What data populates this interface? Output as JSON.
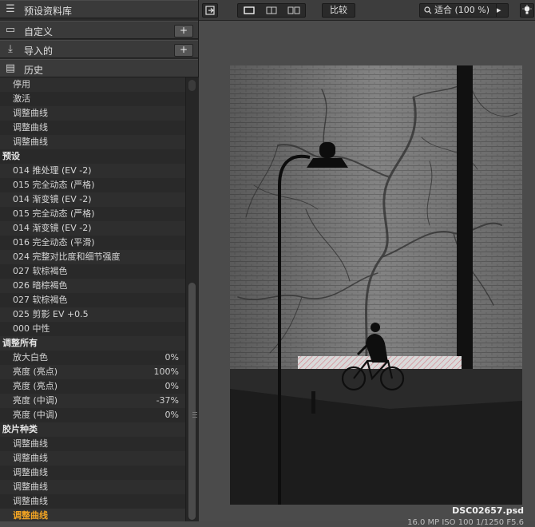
{
  "panels": {
    "presets_library": {
      "label": "预设资料库",
      "icon": "list-icon"
    },
    "custom": {
      "label": "自定义",
      "icon": "custom-icon",
      "add": "+"
    },
    "imported": {
      "label": "导入的",
      "icon": "import-icon",
      "add": "+"
    },
    "history": {
      "label": "历史",
      "icon": "history-icon"
    }
  },
  "history": [
    {
      "label": "停用"
    },
    {
      "label": "激活"
    },
    {
      "label": "调整曲线"
    },
    {
      "label": "调整曲线"
    },
    {
      "label": "调整曲线"
    },
    {
      "label": "预设",
      "group": true
    },
    {
      "label": "014 推处理 (EV -2)"
    },
    {
      "label": "015 完全动态 (严格)"
    },
    {
      "label": "014 渐变镜 (EV -2)"
    },
    {
      "label": "015 完全动态 (严格)"
    },
    {
      "label": "014 渐变镜 (EV -2)"
    },
    {
      "label": "016 完全动态 (平滑)"
    },
    {
      "label": "024 完整对比度和细节强度"
    },
    {
      "label": "027 软棕褐色"
    },
    {
      "label": "026 暗棕褐色"
    },
    {
      "label": "027 软棕褐色"
    },
    {
      "label": "025 剪影 EV +0.5"
    },
    {
      "label": "000 中性"
    },
    {
      "label": "调整所有",
      "group": true
    },
    {
      "label": "放大白色",
      "value": "0%"
    },
    {
      "label": "亮度 (亮点)",
      "value": "100%"
    },
    {
      "label": "亮度 (亮点)",
      "value": "0%"
    },
    {
      "label": "亮度 (中调)",
      "value": "-37%"
    },
    {
      "label": "亮度 (中调)",
      "value": "0%"
    },
    {
      "label": "胶片种类",
      "group": true
    },
    {
      "label": "调整曲线"
    },
    {
      "label": "调整曲线"
    },
    {
      "label": "调整曲线"
    },
    {
      "label": "调整曲线"
    },
    {
      "label": "调整曲线"
    },
    {
      "label": "调整曲线",
      "active": true
    }
  ],
  "toolbar": {
    "compare": "比较",
    "zoom": "适合 (100 %)",
    "icons": [
      "exit-icon",
      "single-view-icon",
      "split-view-icon",
      "side-by-side-icon",
      "search-icon",
      "arrow-right-icon",
      "bulb-icon"
    ]
  },
  "viewer": {
    "filename": "DSC02657.psd",
    "info": "16.0 MP ISO 100 1/1250 F5.6"
  },
  "colors": {
    "active_item": "#f5a623",
    "panel_bg": "#2b2b2b",
    "viewer_bg": "#4b4b4b"
  }
}
